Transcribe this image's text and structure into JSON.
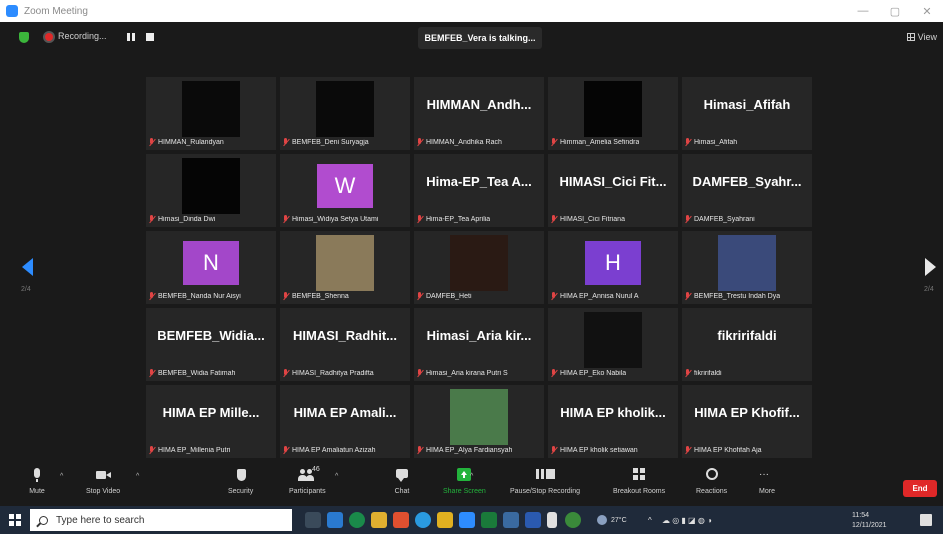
{
  "window": {
    "title": "Zoom Meeting"
  },
  "topbar": {
    "recording_label": "Recording...",
    "talking_label": "BEMFEB_Vera is talking...",
    "view_label": "View"
  },
  "gallery": {
    "page_left": "2/4",
    "page_right": "2/4",
    "tiles": [
      {
        "type": "video",
        "bg": "#0a0a0a",
        "label": "HIMMAN_Rulandyan"
      },
      {
        "type": "video",
        "bg": "#0a0a0a",
        "label": "BEMFEB_Deni Suryagja"
      },
      {
        "type": "name",
        "display": "HIMMAN_Andh...",
        "label": "HIMMAN_Andhika Rach"
      },
      {
        "type": "video",
        "bg": "#050505",
        "label": "Himman_Amelia Sefindra"
      },
      {
        "type": "name",
        "display": "Himasi_Afifah",
        "label": "Himasi_Afifah"
      },
      {
        "type": "video",
        "bg": "#050505",
        "label": "Himasi_Dinda Dwi"
      },
      {
        "type": "letter",
        "letter": "W",
        "bg": "#b14ccf",
        "label": "Himasi_Widiya Setya Utami"
      },
      {
        "type": "name",
        "display": "Hima-EP_Tea A...",
        "label": "Hima-EP_Tea Aprilia"
      },
      {
        "type": "name",
        "display": "HIMASI_Cici Fit...",
        "label": "HIMASI_Cici Fitriana"
      },
      {
        "type": "name",
        "display": "DAMFEB_Syahr...",
        "label": "DAMFEB_Syahrani"
      },
      {
        "type": "letter",
        "letter": "N",
        "bg": "#a347c9",
        "label": "BEMFEB_Nanda Nur Aisyi"
      },
      {
        "type": "photo",
        "bg": "#8a7a5a",
        "label": "BEMFEB_Shenna"
      },
      {
        "type": "photo",
        "bg": "#2a1a14",
        "label": "DAMFEB_Heti"
      },
      {
        "type": "letter",
        "letter": "H",
        "bg": "#7b3fd0",
        "label": "HIMA EP_Annisa Nurul A"
      },
      {
        "type": "photo",
        "bg": "#3a4a7a",
        "label": "BEMFEB_Trestu Indah Dya"
      },
      {
        "type": "name",
        "display": "BEMFEB_Widia...",
        "label": "BEMFEB_Widia Fatimah"
      },
      {
        "type": "name",
        "display": "HIMASI_Radhit...",
        "label": "HIMASI_Radhitya Pradifta"
      },
      {
        "type": "name",
        "display": "Himasi_Aria kir...",
        "label": "Himasi_Aria kirana Putri S"
      },
      {
        "type": "photo",
        "bg": "#111111",
        "label": "HIMA EP_Eko Nabila"
      },
      {
        "type": "name",
        "display": "fikririfaldi",
        "label": "fikririfaldi"
      },
      {
        "type": "name",
        "display": "HIMA EP Mille...",
        "label": "HIMA EP_Millenia Putri"
      },
      {
        "type": "name",
        "display": "HIMA EP Amali...",
        "label": "HIMA EP Amaliatun Azizah"
      },
      {
        "type": "photo",
        "bg": "#4a7a4a",
        "label": "HIMA EP_Alya Fardiansyah"
      },
      {
        "type": "name",
        "display": "HIMA EP kholik...",
        "label": "HIMA EP kholik setiawan"
      },
      {
        "type": "name",
        "display": "HIMA EP Khofif...",
        "label": "HIMA EP Khofifah Aja"
      }
    ]
  },
  "toolbar": {
    "mute": "Mute",
    "stop_video": "Stop Video",
    "security": "Security",
    "participants": "Participants",
    "participants_count": "46",
    "chat": "Chat",
    "share_screen": "Share Screen",
    "recording": "Pause/Stop Recording",
    "breakout": "Breakout Rooms",
    "reactions": "Reactions",
    "more": "More",
    "end": "End"
  },
  "taskbar": {
    "search_placeholder": "Type here to search",
    "weather": "27°C",
    "time": "11:54",
    "date": "12/11/2021"
  }
}
